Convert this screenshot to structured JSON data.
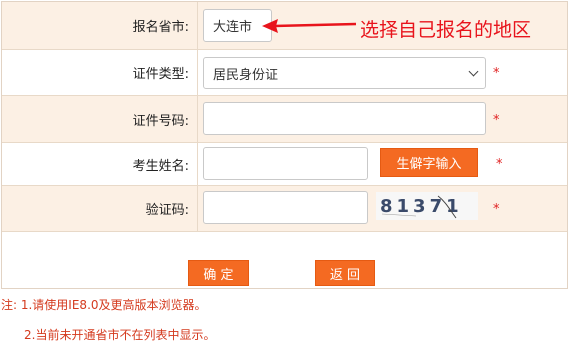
{
  "form": {
    "province": {
      "label": "报名省市:",
      "value": "大连市"
    },
    "id_type": {
      "label": "证件类型:",
      "selected": "居民身份证"
    },
    "id_number": {
      "label": "证件号码:",
      "value": ""
    },
    "name": {
      "label": "考生姓名:",
      "value": "",
      "rare_char_button": "生僻字输入"
    },
    "captcha": {
      "label": "验证码:",
      "value": "",
      "image_text": "81371"
    },
    "required_mark": "*"
  },
  "annotation": {
    "text": "选择自己报名的地区",
    "color": "#e8141c"
  },
  "buttons": {
    "confirm": "确 定",
    "back": "返 回"
  },
  "notes": {
    "line1": "注: 1.请使用IE8.0及更高版本浏览器。",
    "line2": "2.当前未开通省市不在列表中显示。"
  },
  "colors": {
    "accent": "#f46a22",
    "row_shade": "#fcf0e4",
    "required": "#e02020",
    "note_text": "#d43a1e"
  }
}
